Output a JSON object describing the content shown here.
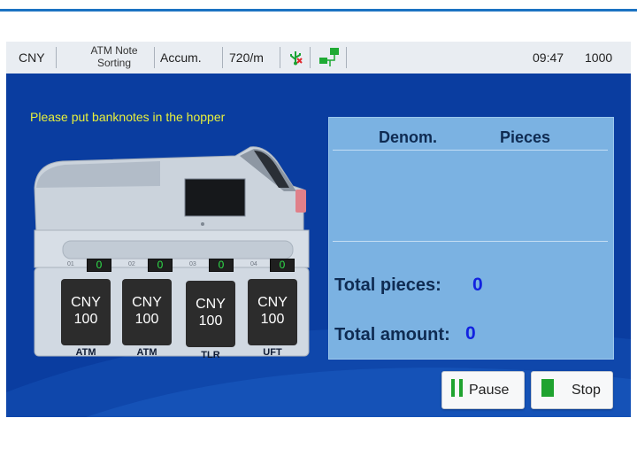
{
  "status_bar": {
    "currency": "CNY",
    "mode_line1": "ATM Note",
    "mode_line2": "Sorting",
    "count_mode": "Accum.",
    "speed": "720/m",
    "time": "09:47",
    "batch": "1000"
  },
  "hint": "Please put banknotes in the hopper",
  "pockets": [
    {
      "number": "01",
      "count": "0",
      "currency": "CNY",
      "denom": "100",
      "label": "ATM"
    },
    {
      "number": "02",
      "count": "0",
      "currency": "CNY",
      "denom": "100",
      "label": "ATM"
    },
    {
      "number": "03",
      "count": "0",
      "currency": "CNY",
      "denom": "100",
      "label": "TLR"
    },
    {
      "number": "04",
      "count": "0",
      "currency": "CNY",
      "denom": "100",
      "label": "UFT"
    }
  ],
  "result_panel": {
    "col_denom": "Denom.",
    "col_pieces": "Pieces",
    "total_pieces_label": "Total pieces:",
    "total_pieces_value": "0",
    "total_amount_label": "Total amount:",
    "total_amount_value": "0"
  },
  "buttons": {
    "pause": "Pause",
    "stop": "Stop"
  },
  "colors": {
    "background": "#0a3da0",
    "hint_text": "#e7ef3c",
    "panel": "#7bb2e2",
    "total_value": "#1222e0",
    "pocket_counter": "#2fe24a",
    "pause_icon": "#1fa32f",
    "stop_icon": "#1fa32f"
  }
}
